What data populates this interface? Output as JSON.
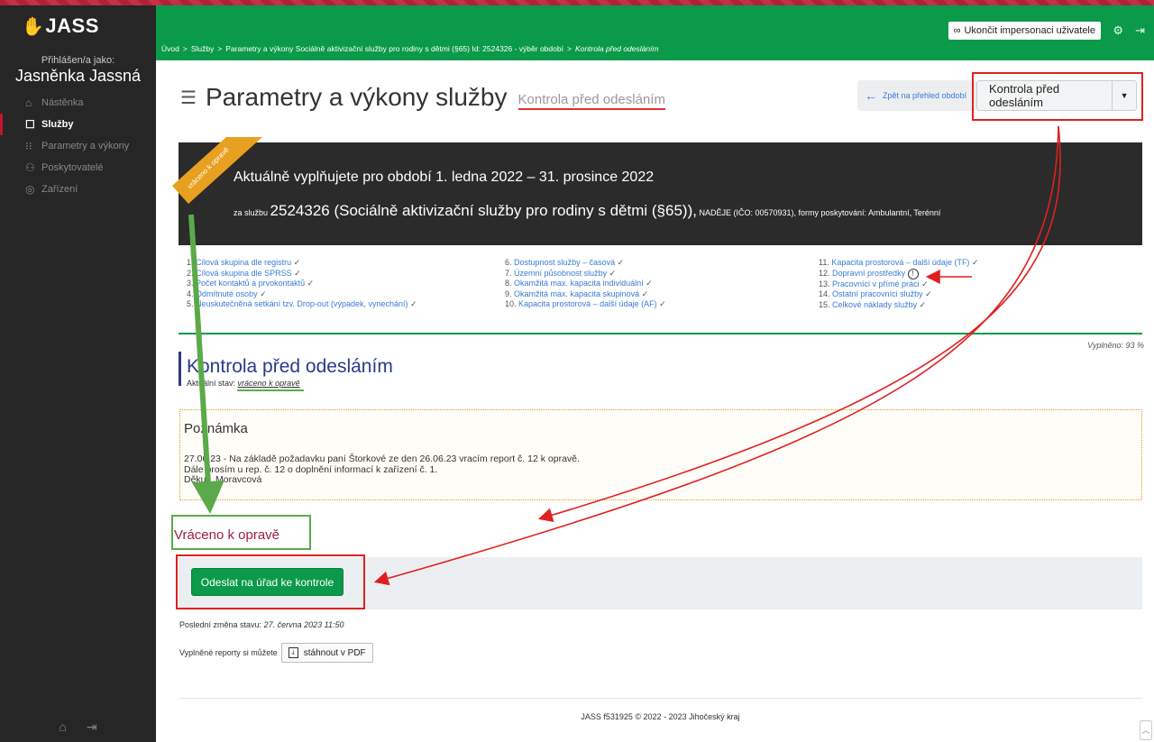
{
  "sidebar": {
    "logo": "JASS",
    "login_label": "Přihlášen/a jako:",
    "user_name": "Jasněnka Jassná",
    "items": [
      {
        "label": "Nástěnka",
        "icon": "home-icon"
      },
      {
        "label": "Služby",
        "icon": "bookmark-icon"
      },
      {
        "label": "Parametry a výkony",
        "icon": "grid-icon"
      },
      {
        "label": "Poskytovatelé",
        "icon": "users-icon"
      },
      {
        "label": "Zařízení",
        "icon": "location-icon"
      }
    ]
  },
  "topbar": {
    "impersonate_label": "Ukončit impersonaci uživatele",
    "breadcrumb": {
      "home": "Úvod",
      "services": "Služby",
      "params": "Parametry a výkony Sociálně aktivizační služby pro rodiny s dětmi (§65) Id: 2524326 - výběr období",
      "current": "Kontrola před odesláním"
    }
  },
  "header": {
    "title": "Parametry a výkony služby",
    "subtitle": "Kontrola před odesláním",
    "back_label": "Zpět na přehled období",
    "state_label": "Kontrola před odesláním"
  },
  "banner": {
    "ribbon": "vráceno k opravě",
    "period_line": "Aktuálně vyplňujete pro období 1. ledna 2022 – 31. prosince 2022",
    "service_prefix": "za službu",
    "service_name": "2524326 (Sociálně aktivizační služby pro rodiny s dětmi (§65)),",
    "service_suffix": "NADĚJE (IČO: 00570931), formy poskytování: Ambulantní, Terénní"
  },
  "checklist": {
    "col1": [
      {
        "num": "1.",
        "label": "Cílová skupina dle registru",
        "mark": "✓"
      },
      {
        "num": "2.",
        "label": "Cílová skupina dle SPRSS",
        "mark": "✓"
      },
      {
        "num": "3.",
        "label": "Počet kontaktů a prvokontaktů",
        "mark": "✓"
      },
      {
        "num": "4.",
        "label": "Odmítnuté osoby",
        "mark": "✓"
      },
      {
        "num": "5.",
        "label": "Neuskutečněná setkání tzv. Drop-out (výpadek, vynechání)",
        "mark": "✓"
      }
    ],
    "col2": [
      {
        "num": "6.",
        "label": "Dostupnost služby – časová",
        "mark": "✓"
      },
      {
        "num": "7.",
        "label": "Územní působnost služby",
        "mark": "✓"
      },
      {
        "num": "8.",
        "label": "Okamžitá max. kapacita individuální",
        "mark": "✓"
      },
      {
        "num": "9.",
        "label": "Okamžitá max. kapacita skupinová",
        "mark": "✓"
      },
      {
        "num": "10.",
        "label": "Kapacita prostorová – další údaje (AF)",
        "mark": "✓"
      }
    ],
    "col3": [
      {
        "num": "11.",
        "label": "Kapacita prostorová – další údaje (TF)",
        "mark": "✓"
      },
      {
        "num": "12.",
        "label": "Dopravní prostředky",
        "mark": "!"
      },
      {
        "num": "13.",
        "label": "Pracovníci v přímé práci",
        "mark": "✓"
      },
      {
        "num": "14.",
        "label": "Ostatní pracovníci služby",
        "mark": "✓"
      },
      {
        "num": "15.",
        "label": "Celkové náklady služby",
        "mark": "✓"
      }
    ],
    "filled": "Vyplněno: 93 %"
  },
  "check": {
    "title": "Kontrola před odesláním",
    "status_label": "Aktuální stav:",
    "status_value": "vráceno k opravě"
  },
  "note": {
    "title": "Poznámka",
    "text": "27.06.23 - Na základě požadavku paní Štorkové ze den 26.06.23 vracím report č. 12 k opravě.\nDále prosím u rep. č. 12 o doplnění informací k zařízení č. 1.\nDěkuji. Moravcová"
  },
  "returned": "Vráceno k opravě",
  "submit_label": "Odeslat na úřad ke kontrole",
  "last_change": {
    "label": "Poslední změna stavu:",
    "value": "27. června 2023 11:50"
  },
  "pdf": {
    "label": "Vyplněné reporty si můžete",
    "button": "stáhnout v PDF"
  },
  "footer": "JASS f531925 © 2022 - 2023 Jihočeský kraj",
  "colors": {
    "brand_green": "#0a9a4a",
    "sidebar": "#262626",
    "accent_red": "#c4142d",
    "link_blue": "#3a7bd5"
  }
}
